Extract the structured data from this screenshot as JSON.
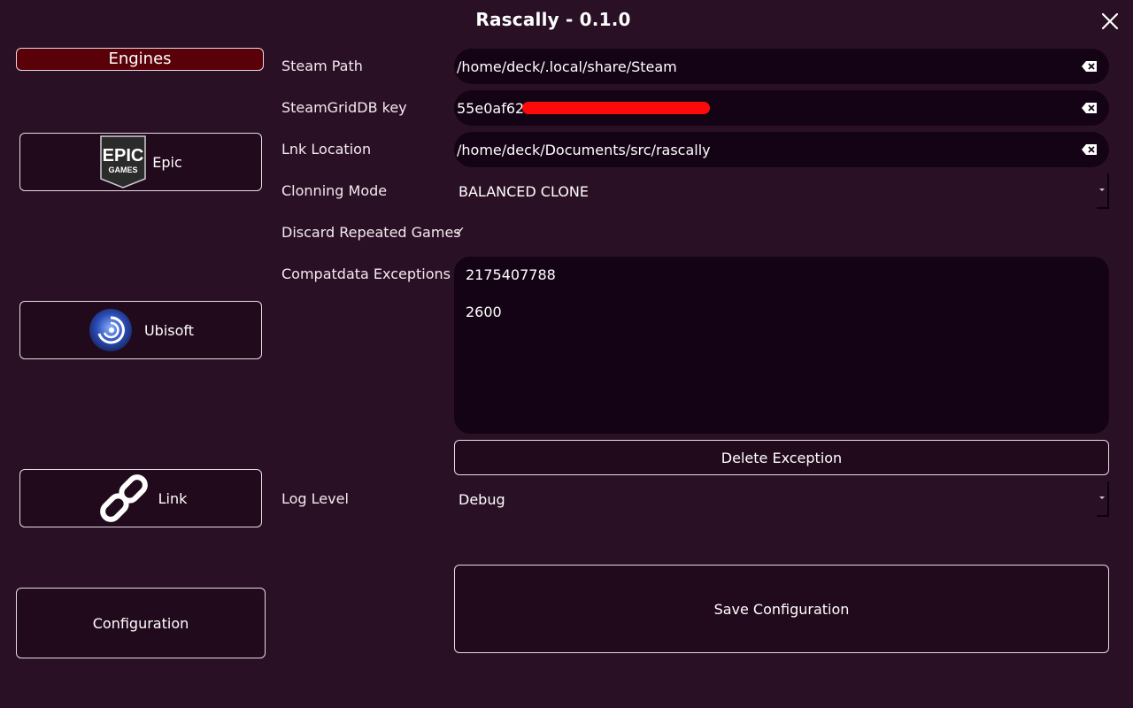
{
  "window": {
    "title": "Rascally - 0.1.0"
  },
  "sidebar": {
    "header": "Engines",
    "items": [
      {
        "label": "Epic",
        "icon": "epic-games-logo-icon"
      },
      {
        "label": "Ubisoft",
        "icon": "ubisoft-logo-icon"
      },
      {
        "label": "Link",
        "icon": "chain-link-icon"
      }
    ],
    "config_label": "Configuration"
  },
  "form": {
    "steam_path": {
      "label": "Steam Path",
      "value": "/home/deck/.local/share/Steam"
    },
    "steamgriddb_key": {
      "label": "SteamGridDB key",
      "value": "55e0af62"
    },
    "lnk_location": {
      "label": "Lnk Location",
      "value": "/home/deck/Documents/src/rascally"
    },
    "cloning_mode": {
      "label": "Clonning Mode",
      "value": "BALANCED CLONE"
    },
    "discard_repeated": {
      "label": "Discard Repeated Games",
      "checked": "✓"
    },
    "compatdata_exceptions": {
      "label": "Compatdata Exceptions",
      "items": [
        "2175407788",
        "2600"
      ]
    },
    "delete_exception_label": "Delete Exception",
    "log_level": {
      "label": "Log Level",
      "value": "Debug"
    },
    "save_label": "Save Configuration"
  },
  "colors": {
    "background": "#2a1024",
    "field_background": "#140314",
    "header_active": "#5a0008",
    "redaction": "#ff0a0a"
  }
}
